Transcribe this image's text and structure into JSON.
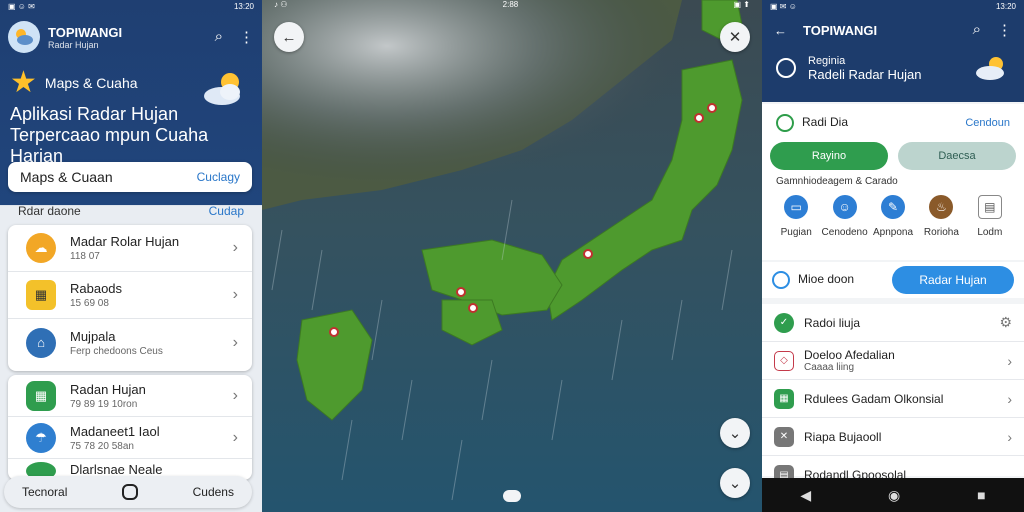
{
  "left": {
    "status_time": "13:20",
    "app_title": "TOPIWANGI",
    "app_subtitle": "Radar Hujan",
    "promo_label": "Maps & Cuaha",
    "headline": "Aplikasi Radar Hujan Terpercaao mpun Cuaha Harjan",
    "maps_tab_label": "Maps & Cuaan",
    "maps_tab_link": "Cuclagy",
    "section_title": "Rdar daone",
    "section_link": "Cudap",
    "items": [
      {
        "title": "Madar Rolar Hujan",
        "sub": "118 07"
      },
      {
        "title": "Rabaods",
        "sub": "15 69 08"
      },
      {
        "title": "Mujpala",
        "sub": "Ferp chedoons Ceus"
      }
    ],
    "items2": [
      {
        "title": "Radan Hujan",
        "sub": "79 89 19 10ron"
      },
      {
        "title": "Madaneet1 Iaol",
        "sub": "75 78 20 58an"
      },
      {
        "title": "Dlarlsnae Neale",
        "sub": ""
      }
    ],
    "bottom_left": "Tecnoral",
    "bottom_right": "Cudens"
  },
  "mid": {
    "status_time": "2:88"
  },
  "right": {
    "status_time": "13:20",
    "title": "TOPIWANGI",
    "sub_a": "Reginia",
    "sub_b": "Radeli Radar Hujan",
    "chip_label": "Radi Dia",
    "chip_link": "Cendoun",
    "btn_green": "Rayino",
    "btn_light": "Daecsa",
    "caption": "Gamnhiodeagem & Carado",
    "icons": [
      {
        "icon": "tv-icon",
        "label": "Pugian"
      },
      {
        "icon": "person-icon",
        "label": "Cenodeno"
      },
      {
        "icon": "pen-icon",
        "label": "Apnpona"
      },
      {
        "icon": "flame-icon",
        "label": "Rorioha"
      },
      {
        "icon": "map-icon",
        "label": "Lodm"
      }
    ],
    "row2_label": "Mioe doon",
    "row2_button": "Radar Hujan",
    "list": [
      {
        "title": "Radoi liuja",
        "sub": ""
      },
      {
        "title": "Doeloo Afedalian",
        "sub": "Caaaa liing"
      },
      {
        "title": "Rdulees Gadam Olkonsial",
        "sub": ""
      },
      {
        "title": "Riapa Bujaooll",
        "sub": ""
      },
      {
        "title": "Rodandl Gpoosolal",
        "sub": ""
      }
    ]
  },
  "colors": {
    "header_blue": "#1f3f72",
    "accent_blue": "#2d8ee3",
    "accent_green": "#2f9d4e",
    "land_green": "#4e9a2e"
  }
}
